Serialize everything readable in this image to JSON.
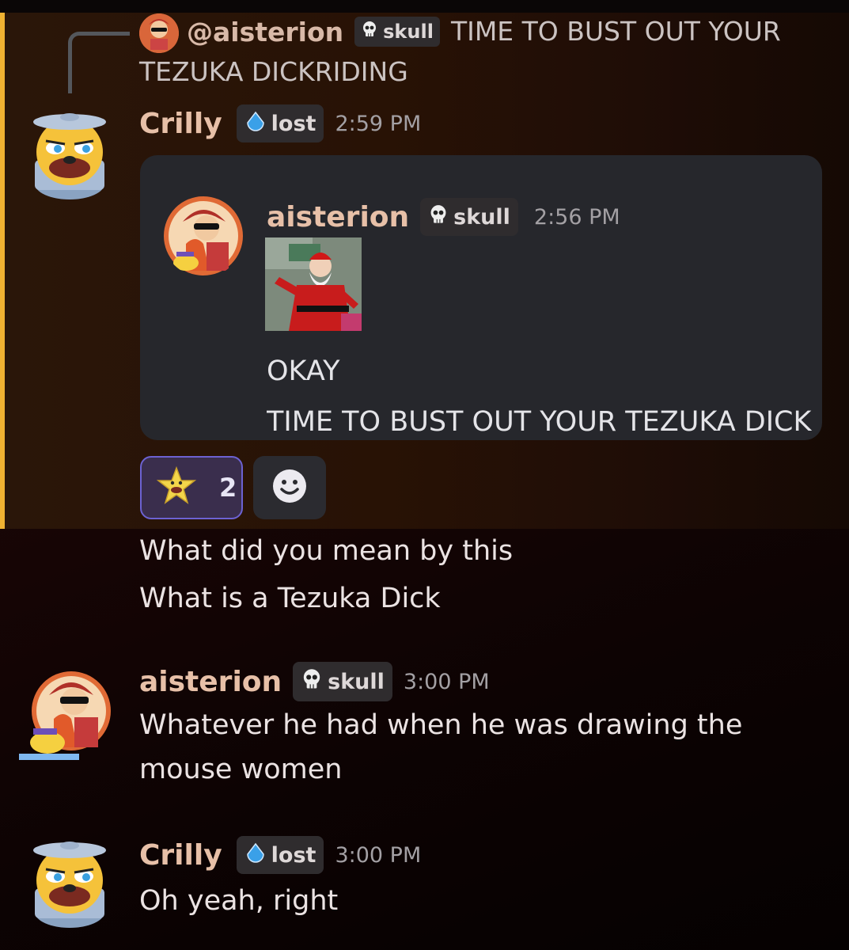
{
  "reply_preview": {
    "mention": "@aisterion",
    "tag": "skull",
    "text_line1": "TIME TO BUST OUT YOUR",
    "text_line2": "TEZUKA DICKRIDING"
  },
  "messages": [
    {
      "username": "Crilly",
      "tag": "lost",
      "time": "2:59 PM",
      "embed": {
        "username": "aisterion",
        "tag": "skull",
        "time": "2:56 PM",
        "line1": "OKAY",
        "line2": "TIME TO BUST OUT YOUR TEZUKA DICK"
      },
      "reaction": {
        "count": "2"
      },
      "lines": [
        "What did you mean by this",
        "What is a Tezuka Dick"
      ]
    },
    {
      "username": "aisterion",
      "tag": "skull",
      "time": "3:00 PM",
      "lines": [
        "Whatever he had when he was drawing the",
        "mouse women"
      ]
    },
    {
      "username": "Crilly",
      "tag": "lost",
      "time": "3:00 PM",
      "lines": [
        "Oh yeah, right"
      ]
    }
  ],
  "colors": {
    "highlight_bar": "#f0b232",
    "username": "#e7c0a8",
    "reaction_border": "#6c62d2"
  },
  "icons": [
    "skull-icon",
    "droplet-icon",
    "star-emoji-icon",
    "add-reaction-icon"
  ]
}
